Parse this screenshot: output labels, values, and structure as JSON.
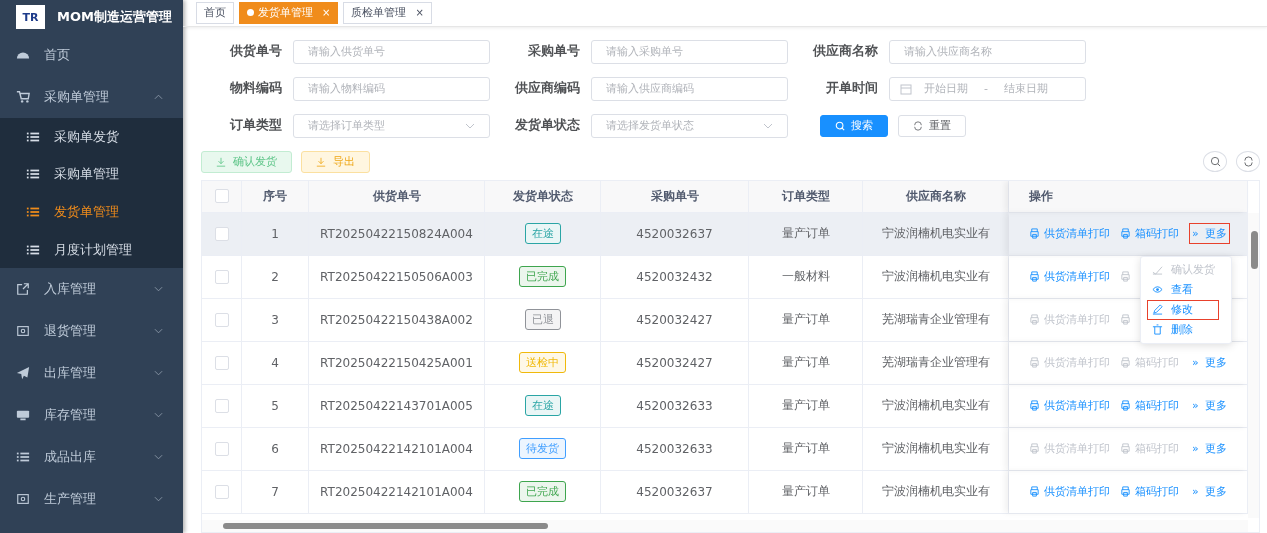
{
  "app": {
    "title": "MOM制造运营管理",
    "logo_text": "TR"
  },
  "sidebar": {
    "items": [
      {
        "label": "首页"
      },
      {
        "label": "采购单管理",
        "expanded": true,
        "children": [
          {
            "label": "采购单发货",
            "selected": false
          },
          {
            "label": "采购单管理",
            "selected": false
          },
          {
            "label": "发货单管理",
            "selected": true
          },
          {
            "label": "月度计划管理",
            "selected": false
          }
        ]
      },
      {
        "label": "入库管理",
        "expanded": false
      },
      {
        "label": "退货管理",
        "expanded": false
      },
      {
        "label": "出库管理",
        "expanded": false
      },
      {
        "label": "库存管理",
        "expanded": false
      },
      {
        "label": "成品出库",
        "expanded": false
      },
      {
        "label": "生产管理",
        "expanded": false
      }
    ]
  },
  "tabs": [
    {
      "label": "首页",
      "selected": false
    },
    {
      "label": "发货单管理",
      "selected": true,
      "close": "×"
    },
    {
      "label": "质检单管理",
      "selected": false,
      "close": "×"
    }
  ],
  "filters": [
    {
      "label": "供货单号",
      "kind": "text",
      "placeholder": "请输入供货单号"
    },
    {
      "label": "采购单号",
      "kind": "text",
      "placeholder": "请输入采购单号"
    },
    {
      "label": "供应商名称",
      "kind": "text",
      "placeholder": "请输入供应商名称"
    },
    {
      "label": "物料编码",
      "kind": "text",
      "placeholder": "请输入物料编码"
    },
    {
      "label": "供应商编码",
      "kind": "text",
      "placeholder": "请输入供应商编码"
    },
    {
      "label": "开单时间",
      "kind": "daterange",
      "placeholder": "开始日期",
      "placeholder_end": "结束日期",
      "separator": "-"
    },
    {
      "label": "订单类型",
      "kind": "select",
      "placeholder": "请选择订单类型"
    },
    {
      "label": "发货单状态",
      "kind": "select",
      "placeholder": "请选择发货单状态"
    }
  ],
  "search_button": "搜索",
  "reset_button": "重置",
  "toolbar": [
    {
      "label": "确认发货",
      "kind": "success"
    },
    {
      "label": "导出",
      "kind": "warning"
    }
  ],
  "table": {
    "select_all_checked": false,
    "columns": [
      "序号",
      "供货单号",
      "发货单状态",
      "采购单号",
      "订单类型",
      "供应商名称",
      "操作"
    ],
    "rows": [
      {
        "checked": false,
        "hovered": true,
        "no": "1",
        "supply_no": "RT20250422150824A004",
        "status": "在途",
        "color": "#2aa5a5",
        "po": "4520032637",
        "order_type": "量产订单",
        "supplier": "宁波润楠机电实业有",
        "ops": [
          {
            "label": "供货清单打印",
            "disabled": false
          },
          {
            "label": "箱码打印",
            "disabled": false
          }
        ],
        "more": {
          "icon": "»",
          "label": "更多",
          "highlighted": true
        }
      },
      {
        "checked": false,
        "hovered": false,
        "no": "2",
        "supply_no": "RT20250422150506A003",
        "status": "已完成",
        "color": "#3ea54e",
        "po": "4520032432",
        "order_type": "一般材料",
        "supplier": "宁波润楠机电实业有",
        "ops": [
          {
            "label": "供货清单打印",
            "disabled": false
          }
        ]
      },
      {
        "checked": false,
        "hovered": false,
        "no": "3",
        "supply_no": "RT20250422150438A002",
        "status": "已退",
        "color": "#909399",
        "po": "4520032427",
        "order_type": "量产订单",
        "supplier": "芜湖瑞青企业管理有",
        "ops": [
          {
            "label": "供货清单打印",
            "disabled": true
          }
        ]
      },
      {
        "checked": false,
        "hovered": false,
        "no": "4",
        "supply_no": "RT20250422150425A001",
        "status": "送检中",
        "color": "#f0b90b",
        "po": "4520032427",
        "order_type": "量产订单",
        "supplier": "芜湖瑞青企业管理有",
        "ops": [
          {
            "label": "供货清单打印",
            "disabled": true
          },
          {
            "label": "箱码打印",
            "disabled": true
          }
        ],
        "more": {
          "icon": "»",
          "label": "更多",
          "highlighted": false
        }
      },
      {
        "checked": false,
        "hovered": false,
        "no": "5",
        "supply_no": "RT20250422143701A005",
        "status": "在途",
        "color": "#2aa5a5",
        "po": "4520032633",
        "order_type": "量产订单",
        "supplier": "宁波润楠机电实业有",
        "ops": [
          {
            "label": "供货清单打印",
            "disabled": false
          },
          {
            "label": "箱码打印",
            "disabled": false
          }
        ],
        "more": {
          "icon": "»",
          "label": "更多",
          "highlighted": false
        }
      },
      {
        "checked": false,
        "hovered": false,
        "no": "6",
        "supply_no": "RT20250422142101A004",
        "status": "待发货",
        "color": "#409eff",
        "po": "4520032633",
        "order_type": "量产订单",
        "supplier": "宁波润楠机电实业有",
        "ops": [
          {
            "label": "供货清单打印",
            "disabled": true
          },
          {
            "label": "箱码打印",
            "disabled": true
          }
        ],
        "more": {
          "icon": "»",
          "label": "更多",
          "highlighted": false
        }
      },
      {
        "checked": false,
        "hovered": false,
        "no": "7",
        "supply_no": "RT20250422142101A004",
        "status": "已完成",
        "color": "#3ea54e",
        "po": "4520032637",
        "order_type": "量产订单",
        "supplier": "宁波润楠机电实业有",
        "ops": [
          {
            "label": "供货清单打印",
            "disabled": false
          },
          {
            "label": "箱码打印",
            "disabled": false
          }
        ],
        "more": {
          "icon": "»",
          "label": "更多",
          "highlighted": false
        }
      }
    ]
  },
  "dropdown": {
    "items": [
      {
        "label": "确认发货",
        "disabled": true,
        "highlighted": false
      },
      {
        "label": "查看",
        "disabled": false,
        "highlighted": false
      },
      {
        "label": "修改",
        "disabled": false,
        "highlighted": true
      },
      {
        "label": "删除",
        "disabled": false,
        "highlighted": false
      }
    ]
  }
}
